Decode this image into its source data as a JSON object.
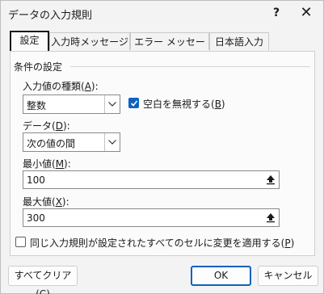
{
  "window": {
    "title": "データの入力規則",
    "help_glyph": "?",
    "close_glyph": "✕"
  },
  "tabs": [
    {
      "label": "設定",
      "active": true
    },
    {
      "label": "入力時メッセージ",
      "active": false
    },
    {
      "label": "エラー メッセージ",
      "active": false
    },
    {
      "label": "日本語入力",
      "active": false
    }
  ],
  "settings": {
    "group_label": "条件の設定",
    "allow_label": "入力値の種類(",
    "allow_key": "A",
    "allow_label_end": "):",
    "allow_value": "整数",
    "ignore_blank_label": "空白を無視する(",
    "ignore_blank_key": "B",
    "ignore_blank_end": ")",
    "ignore_blank_checked": true,
    "data_label": "データ(",
    "data_key": "D",
    "data_label_end": "):",
    "data_value": "次の値の間",
    "min_label": "最小値(",
    "min_key": "M",
    "min_label_end": "):",
    "min_value": "100",
    "max_label": "最大値(",
    "max_key": "X",
    "max_label_end": "):",
    "max_value": "300",
    "apply_all_label": "同じ入力規則が設定されたすべてのセルに変更を適用する(",
    "apply_all_key": "P",
    "apply_all_end": ")",
    "apply_all_checked": false
  },
  "footer": {
    "clear_label": "すべてクリア(",
    "clear_key": "C",
    "clear_end": ")",
    "ok_label": "OK",
    "cancel_label": "キャンセル"
  },
  "colors": {
    "accent": "#0f62c0",
    "background": "#f3f3f3",
    "panel": "#fbfbfb"
  }
}
